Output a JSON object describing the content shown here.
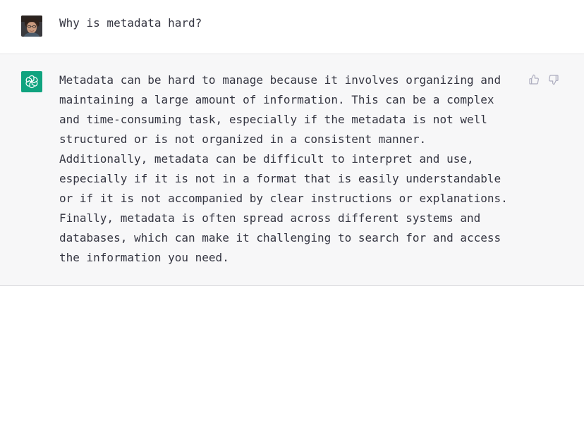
{
  "conversation": {
    "user_message": {
      "text": "Why is metadata hard?"
    },
    "assistant_message": {
      "text": "Metadata can be hard to manage because it involves organizing and\nmaintaining a large amount of information. This can be a complex\nand time-consuming task, especially if the metadata is not well\nstructured or is not organized in a consistent manner.\nAdditionally, metadata can be difficult to interpret and use,\nespecially if it is not in a format that is easily understandable\nor if it is not accompanied by clear instructions or explanations.\nFinally, metadata is often spread across different systems and\ndatabases, which can make it challenging to search for and access\nthe information you need."
    }
  },
  "icons": {
    "user_avatar": "user-avatar-photo",
    "assistant_avatar": "openai-logo-icon",
    "feedback_up": "thumbs-up-icon",
    "feedback_down": "thumbs-down-icon"
  },
  "colors": {
    "assistant_avatar_bg": "#10a37f",
    "assistant_row_bg": "#f7f7f8",
    "text": "#343541",
    "icon_muted": "#acacbe"
  }
}
